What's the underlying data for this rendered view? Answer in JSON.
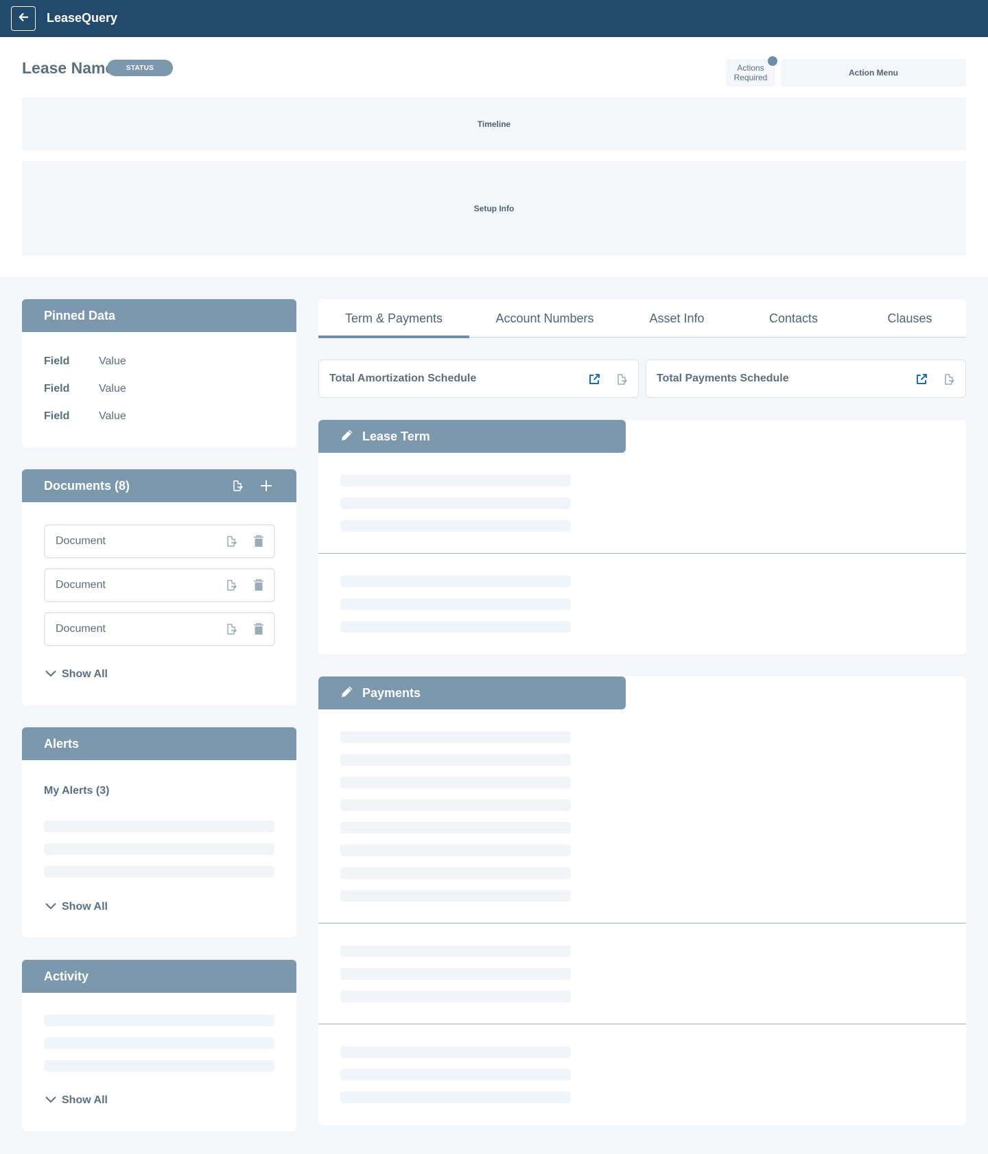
{
  "app": {
    "title": "LeaseQuery",
    "back_icon": "arrow-left-icon"
  },
  "header": {
    "lease_name": "Lease Name",
    "status": "STATUS",
    "actions_required_line1": "Actions",
    "actions_required_line2": "Required",
    "action_menu": "Action Menu",
    "timeline": "Timeline",
    "setup_info": "Setup Info"
  },
  "pinned": {
    "title": "Pinned Data",
    "rows": [
      {
        "field": "Field",
        "value": "Value"
      },
      {
        "field": "Field",
        "value": "Value"
      },
      {
        "field": "Field",
        "value": "Value"
      }
    ]
  },
  "documents": {
    "title": "Documents (8)",
    "items": [
      "Document",
      "Document",
      "Document"
    ],
    "show_all": "Show All"
  },
  "alerts": {
    "title": "Alerts",
    "my_alerts": "My Alerts (3)",
    "show_all": "Show All"
  },
  "activity": {
    "title": "Activity",
    "show_all": "Show All"
  },
  "tabs": [
    {
      "label": "Term & Payments",
      "active": true
    },
    {
      "label": "Account Numbers",
      "active": false
    },
    {
      "label": "Asset Info",
      "active": false
    },
    {
      "label": "Contacts",
      "active": false
    },
    {
      "label": "Clauses",
      "active": false
    }
  ],
  "schedules": {
    "amortization": "Total Amortization Schedule",
    "payments": "Total Payments Schedule"
  },
  "sections": {
    "lease_term": "Lease Term",
    "payments": "Payments"
  },
  "colors": {
    "topbar": "#244a6b",
    "card_header": "#7c98ad",
    "link_blue": "#1a6fb0",
    "text": "#5a6f82",
    "background": "#f4f6f9"
  }
}
